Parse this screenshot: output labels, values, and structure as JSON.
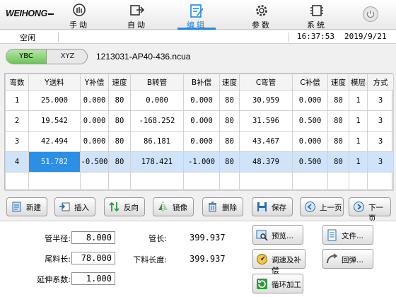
{
  "brand": {
    "logo": "WEIHONG"
  },
  "nav": [
    {
      "label": "手动",
      "icon": "hand-icon"
    },
    {
      "label": "自动",
      "icon": "auto-icon"
    },
    {
      "label": "编辑",
      "icon": "edit-icon",
      "active": true
    },
    {
      "label": "参数",
      "icon": "gear-icon"
    },
    {
      "label": "系统",
      "icon": "system-icon"
    }
  ],
  "status": {
    "text": "空闲",
    "time": "16:37:53",
    "date": "2019/9/21"
  },
  "mode": {
    "options": [
      "YBC",
      "XYZ"
    ],
    "selected": "YBC"
  },
  "file": {
    "name": "1213031-AP40-436.ncua"
  },
  "table": {
    "headers": [
      "弯数",
      "Y送料",
      "Y补偿",
      "速度",
      "B转管",
      "B补偿",
      "速度",
      "C弯管",
      "C补偿",
      "速度",
      "模层",
      "方式"
    ],
    "rows": [
      [
        "1",
        "25.000",
        "0.000",
        "80",
        "0.000",
        "0.000",
        "80",
        "30.959",
        "0.000",
        "80",
        "1",
        "3"
      ],
      [
        "2",
        "19.542",
        "0.000",
        "80",
        "-168.252",
        "0.000",
        "80",
        "31.596",
        "0.500",
        "80",
        "1",
        "3"
      ],
      [
        "3",
        "42.494",
        "0.000",
        "80",
        "86.181",
        "0.000",
        "80",
        "43.467",
        "0.000",
        "80",
        "1",
        "3"
      ],
      [
        "4",
        "51.782",
        "-0.500",
        "80",
        "178.421",
        "-1.000",
        "80",
        "48.379",
        "0.500",
        "80",
        "1",
        "3"
      ]
    ],
    "selected_row": 4
  },
  "toolbar": [
    {
      "label": "新建",
      "icon": "new-file-icon"
    },
    {
      "label": "插入",
      "icon": "insert-icon"
    },
    {
      "label": "反向",
      "icon": "reverse-icon"
    },
    {
      "label": "镜像",
      "icon": "mirror-icon"
    },
    {
      "label": "删除",
      "icon": "trash-icon"
    },
    {
      "label": "保存",
      "icon": "save-icon"
    },
    {
      "label": "上一页",
      "icon": "page-up-icon"
    },
    {
      "label": "下一页",
      "icon": "page-down-icon"
    }
  ],
  "params": {
    "radius_label": "管半径:",
    "radius": "8.000",
    "tail_label": "尾料长:",
    "tail": "78.000",
    "stretch_label": "延伸系数:",
    "stretch": "1.000",
    "length_label": "管长:",
    "length": "399.937",
    "cut_label": "下料长度:",
    "cut": "399.937"
  },
  "actions": {
    "preview": "预览...",
    "speed_comp": "调速及补偿",
    "loop": "循环加工",
    "file": "文件...",
    "springback": "回弹..."
  }
}
